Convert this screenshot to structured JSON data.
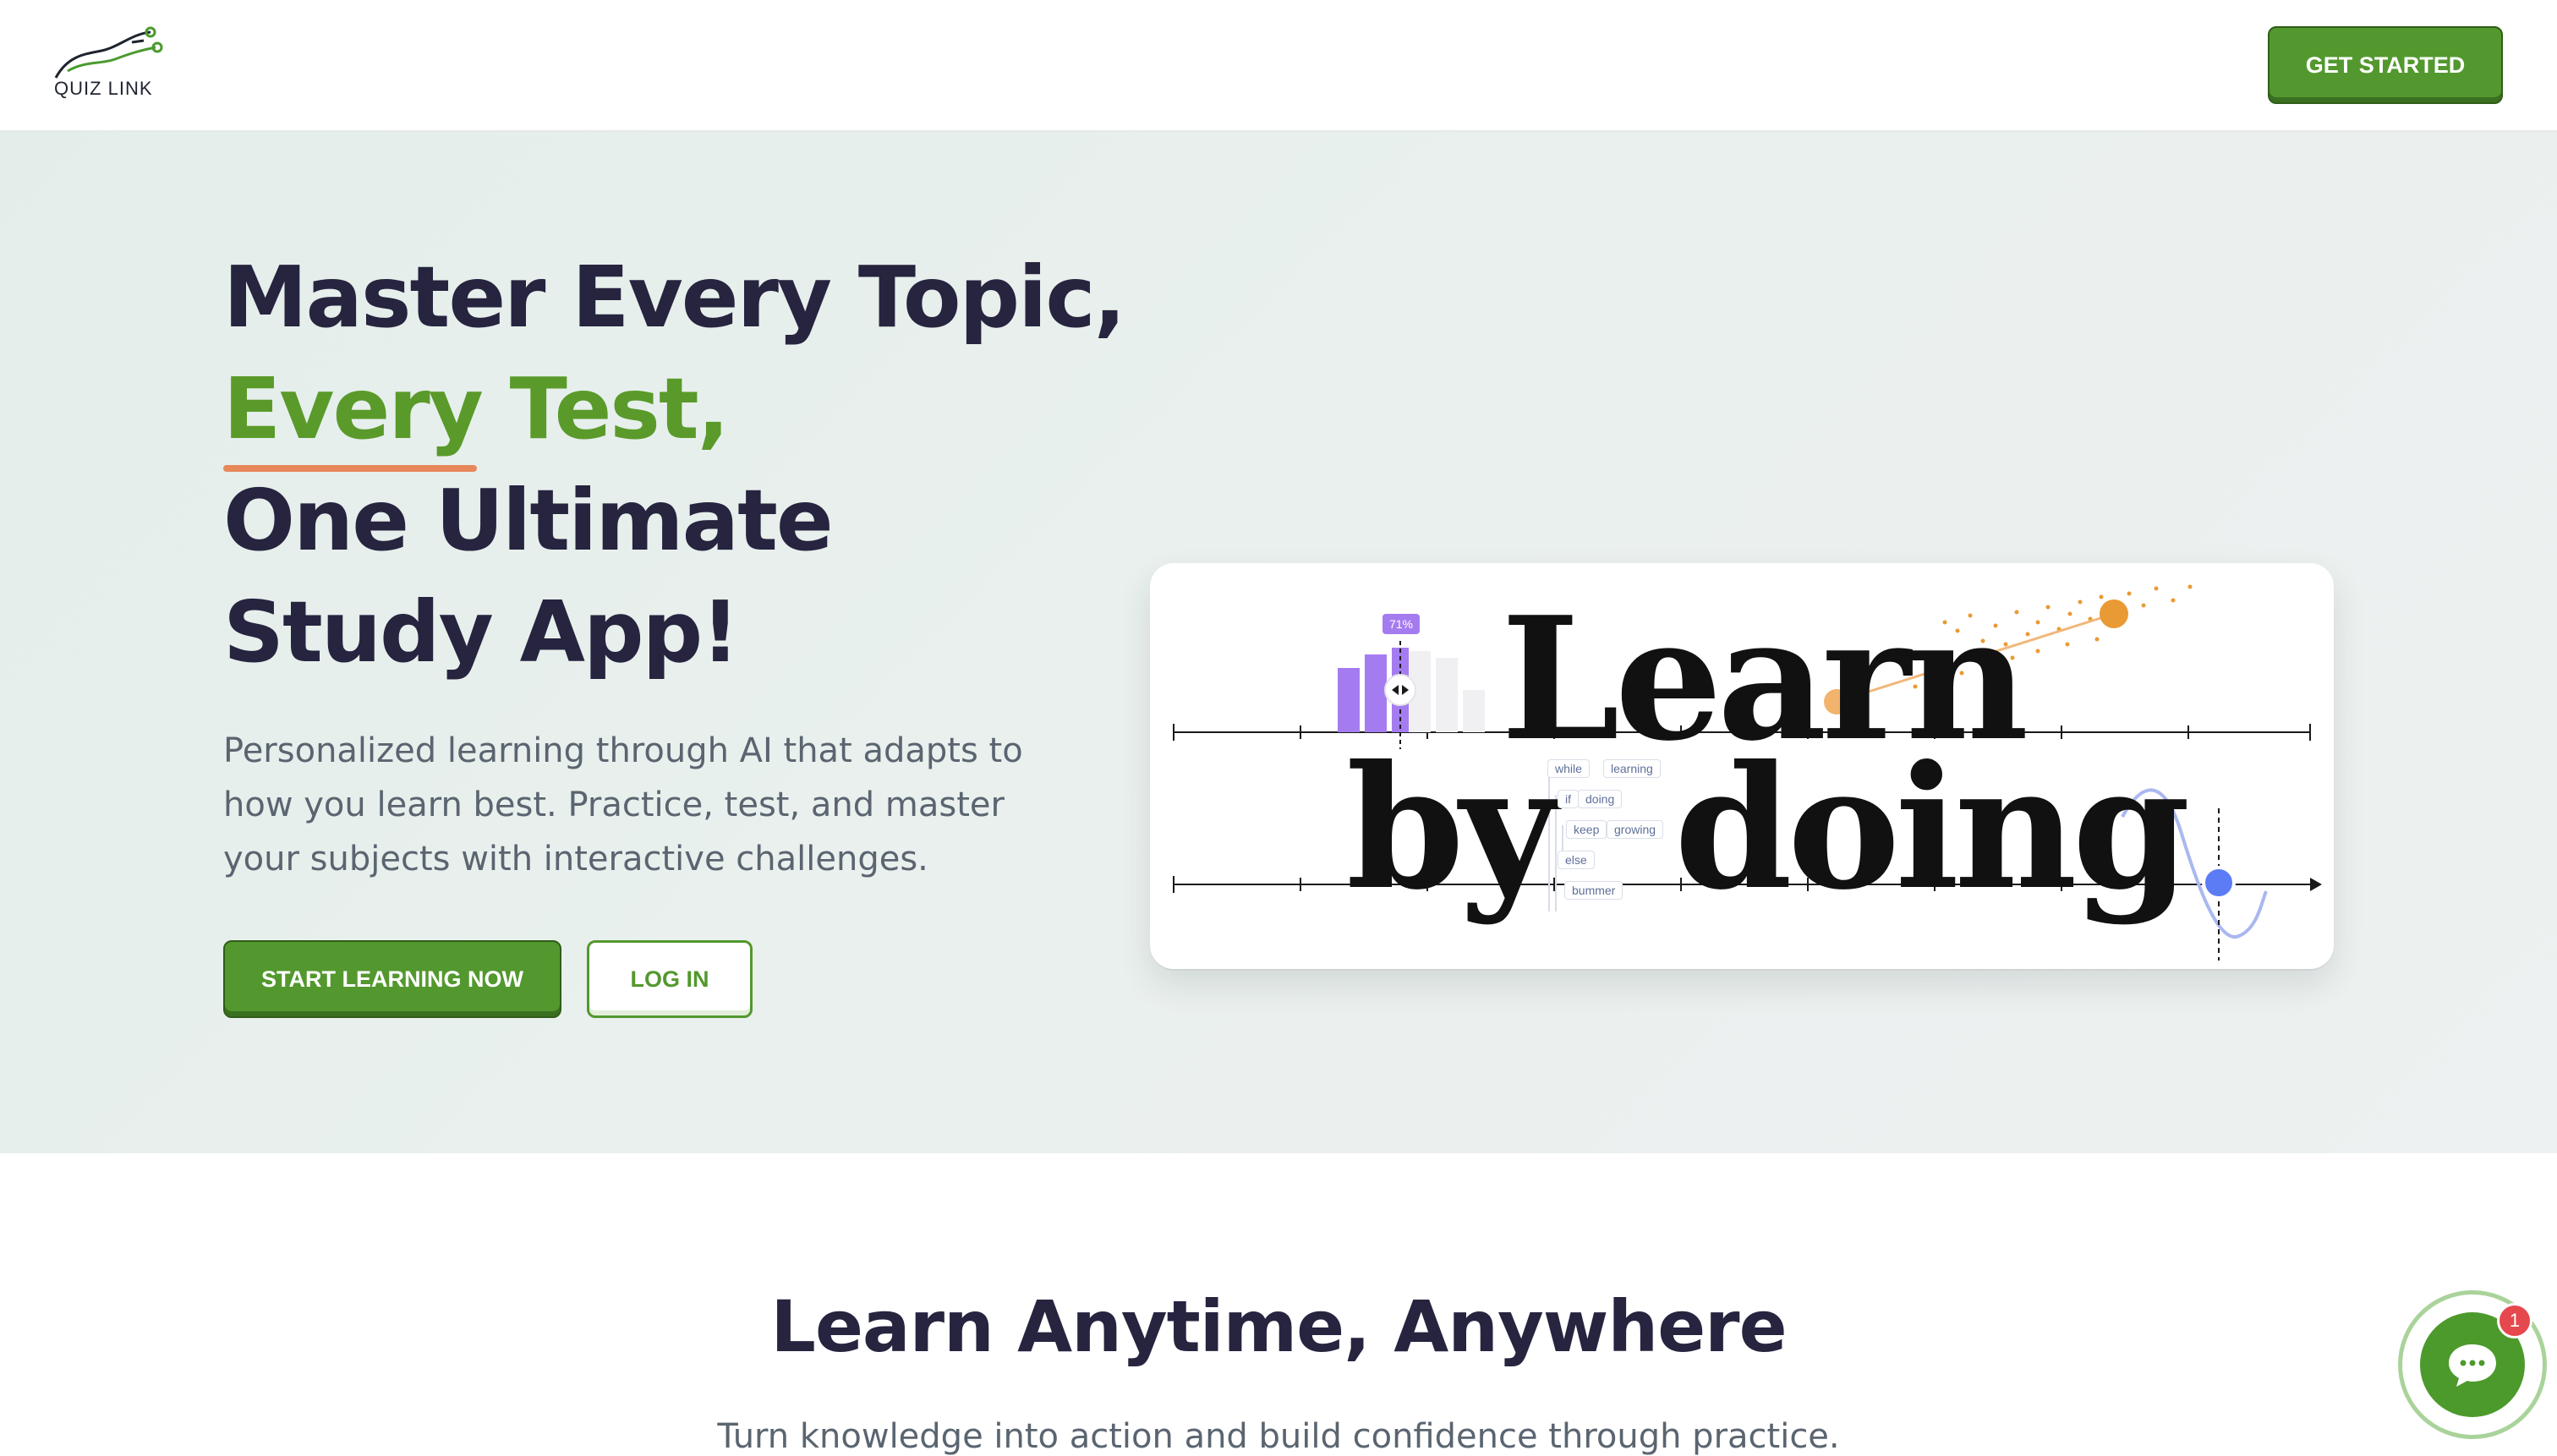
{
  "header": {
    "logo_text": "QUIZ LINK",
    "cta_label": "GET STARTED"
  },
  "hero": {
    "title_line1": "Master Every Topic,",
    "title_line2": "Every Test,",
    "title_line3": "One Ultimate",
    "title_line4": "Study App!",
    "subtitle": "Personalized learning through AI that adapts to how you learn best. Practice, test, and master your subjects with interactive challenges.",
    "primary_button": "START LEARNING NOW",
    "secondary_button": "LOG IN"
  },
  "illustration": {
    "word_learn": "Learn",
    "word_by": "by",
    "word_doing": "doing",
    "percent_badge": "71%",
    "code_chips": [
      "while",
      "learning",
      "if",
      "doing",
      "keep",
      "growing",
      "else",
      "bummer"
    ]
  },
  "lower": {
    "title": "Learn Anytime, Anywhere",
    "subtitle": "Turn knowledge into action and build confidence through practice."
  },
  "chat": {
    "badge_count": "1",
    "icon": "chat-bubble-icon"
  },
  "colors": {
    "brand_green": "#53982e",
    "accent_green_text": "#5a9a2a",
    "underline_orange": "#e8875a",
    "heading_navy": "#26243f",
    "badge_red": "#e5484d"
  }
}
